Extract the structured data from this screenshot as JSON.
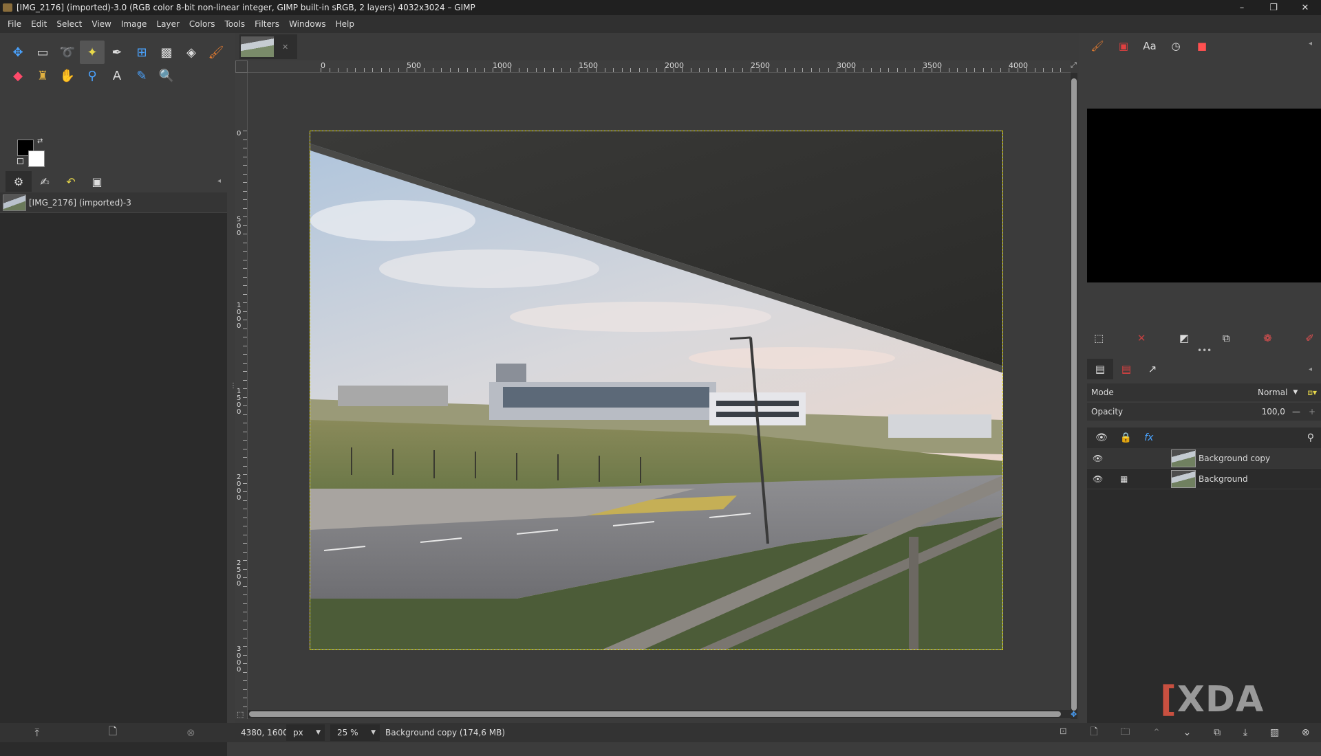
{
  "window": {
    "title": "[IMG_2176] (imported)-3.0 (RGB color 8-bit non-linear integer, GIMP built-in sRGB, 2 layers) 4032x3024 – GIMP",
    "minimize_glyph": "–",
    "maximize_glyph": "❐",
    "close_glyph": "✕"
  },
  "menu": [
    "File",
    "Edit",
    "Select",
    "View",
    "Image",
    "Layer",
    "Colors",
    "Tools",
    "Filters",
    "Windows",
    "Help"
  ],
  "toolbox": {
    "row1": [
      "move-tool-icon",
      "rect-select-icon",
      "free-select-icon",
      "fuzzy-select-icon",
      "paths-tool-icon",
      "transform-tool-icon",
      "warp-tool-icon",
      "bucket-fill-icon",
      "paintbrush-icon"
    ],
    "row2": [
      "eraser-icon",
      "clone-tool-icon",
      "smudge-tool-icon",
      "crop-tool-icon",
      "text-tool-icon",
      "color-picker-icon",
      "zoom-tool-icon"
    ]
  },
  "images_panel": {
    "items": [
      {
        "label": "[IMG_2176] (imported)-3"
      }
    ]
  },
  "ruler": {
    "h_labels": [
      "0",
      "500",
      "1000",
      "1500",
      "2000",
      "2500",
      "3000",
      "3500",
      "4000"
    ],
    "v_labels": [
      "0",
      "500",
      "1000",
      "1500",
      "2000",
      "2500",
      "3000"
    ]
  },
  "status": {
    "coords": "4380, 1600",
    "unit": "px",
    "zoom": "25 %",
    "message": "Background copy (174,6 MB)"
  },
  "layers_panel": {
    "mode_label": "Mode",
    "mode_value": "Normal",
    "opacity_label": "Opacity",
    "opacity_value": "100,0",
    "layers": [
      {
        "name": "Background copy",
        "selected": true
      },
      {
        "name": "Background",
        "selected": false
      }
    ]
  },
  "watermark": {
    "text": "XDA"
  },
  "colors": {
    "accent": "#4aa3ff",
    "selection_border": "#d7d000"
  }
}
